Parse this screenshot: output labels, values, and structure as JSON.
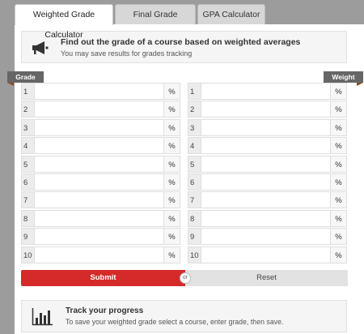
{
  "tabs": [
    {
      "label": "Weighted Grade Calculator",
      "active": true
    },
    {
      "label": "Final Grade Calculator",
      "active": false
    },
    {
      "label": "GPA Calculator",
      "active": false
    }
  ],
  "info": {
    "title": "Find out the grade of a course based on weighted averages",
    "subtitle": "You may save results for grades tracking",
    "icon": "megaphone-icon"
  },
  "columns": {
    "grade_label": "Grade",
    "weight_label": "Weight"
  },
  "rows": [
    {
      "num": "1",
      "unit": "%"
    },
    {
      "num": "2",
      "unit": "%"
    },
    {
      "num": "3",
      "unit": "%"
    },
    {
      "num": "4",
      "unit": "%"
    },
    {
      "num": "5",
      "unit": "%"
    },
    {
      "num": "6",
      "unit": "%"
    },
    {
      "num": "7",
      "unit": "%"
    },
    {
      "num": "8",
      "unit": "%"
    },
    {
      "num": "9",
      "unit": "%"
    },
    {
      "num": "10",
      "unit": "%"
    }
  ],
  "actions": {
    "submit_label": "Submit",
    "or_label": "or",
    "reset_label": "Reset"
  },
  "track": {
    "title": "Track your progress",
    "subtitle": "To save your weighted grade select a course, enter grade, then save.",
    "icon": "bar-chart-icon"
  },
  "colors": {
    "accent": "#d42a2a",
    "tag": "#666666"
  }
}
